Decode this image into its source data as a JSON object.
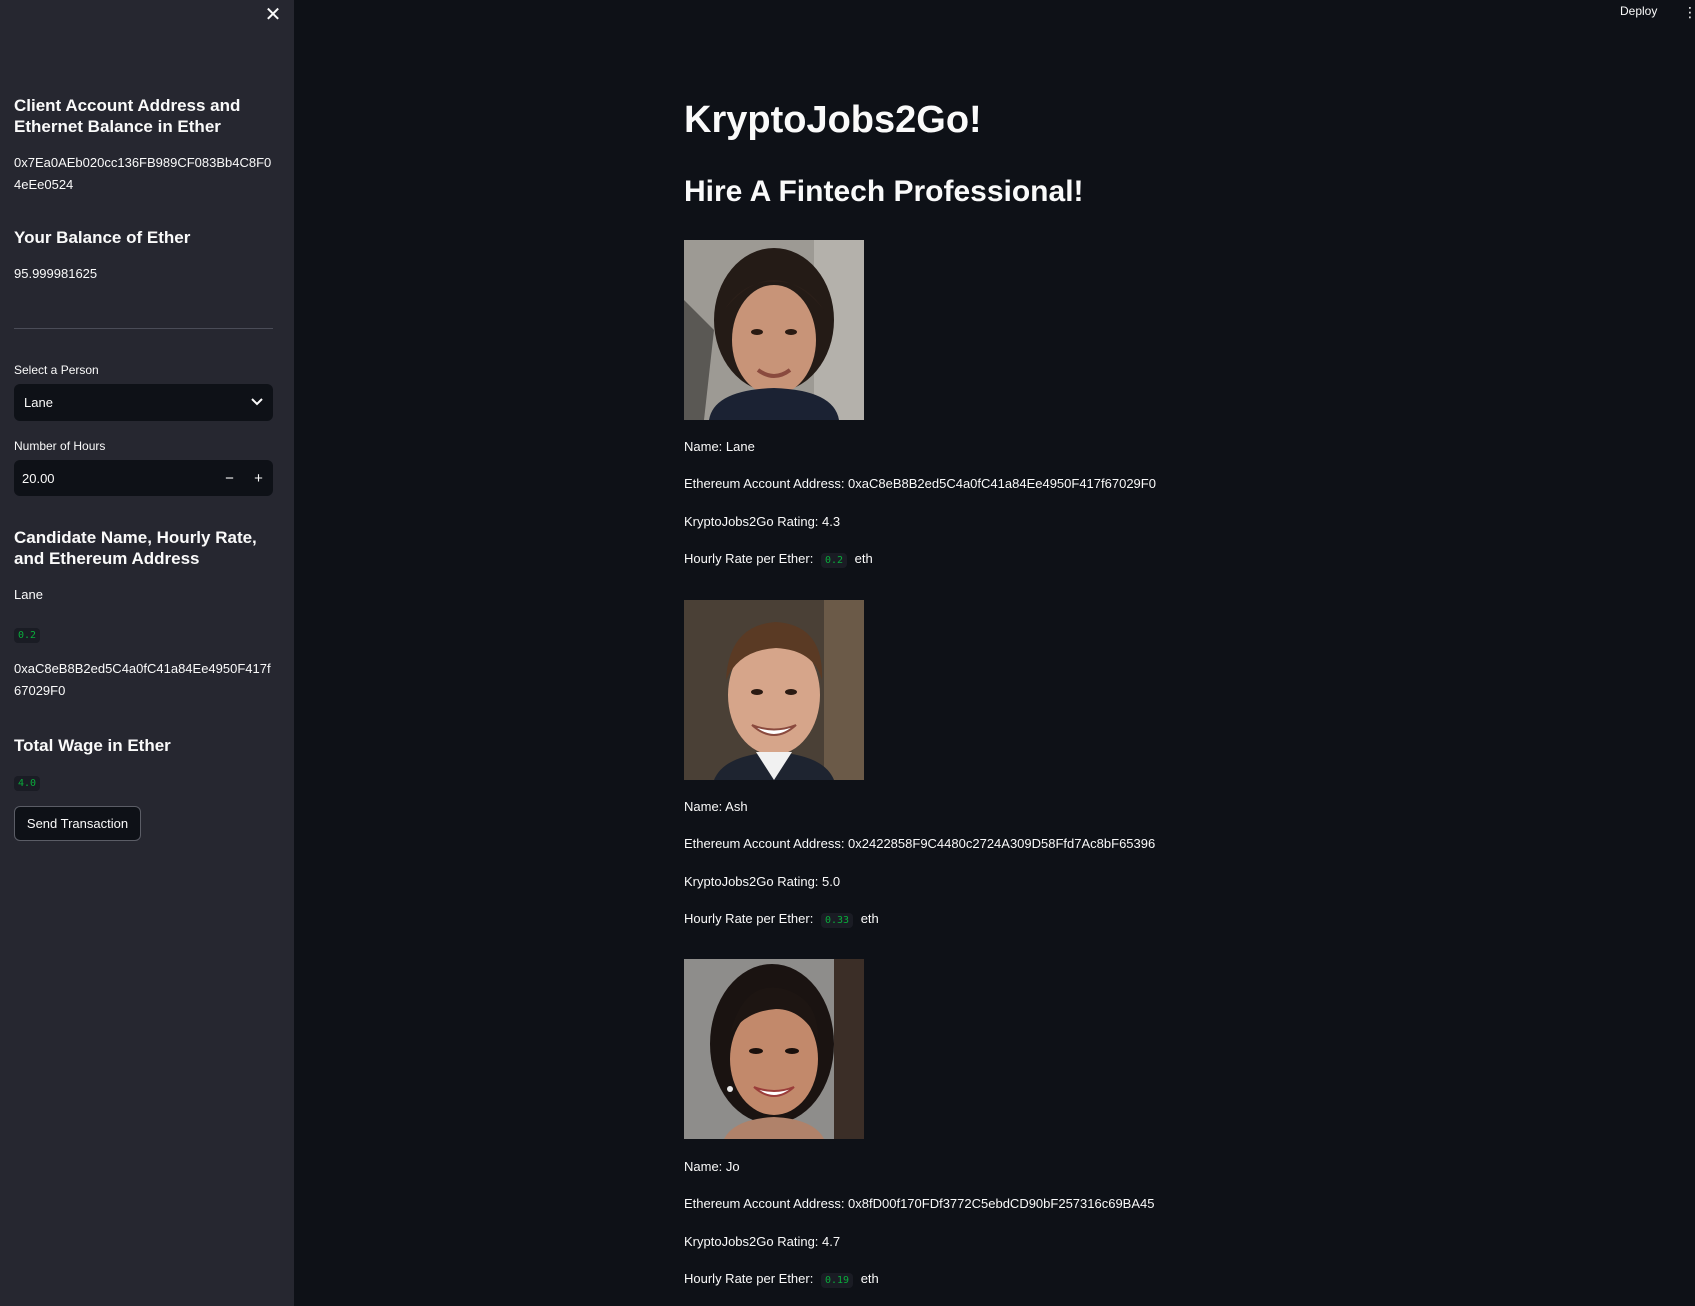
{
  "topbar": {
    "deploy_label": "Deploy",
    "menu_icon": "kebab-menu-icon"
  },
  "sidebar": {
    "close_icon": "close-icon",
    "account_heading": "Client Account Address and Ethernet Balance in Ether",
    "account_address": "0x7Ea0AEb020cc136FB989CF083Bb4C8F04eEe0524",
    "balance_heading": "Your Balance of Ether",
    "balance_value": "95.999981625",
    "select_label": "Select a Person",
    "select_value": "Lane",
    "hours_label": "Number of Hours",
    "hours_value": "20.00",
    "candidate_heading": "Candidate Name, Hourly Rate, and Ethereum Address",
    "candidate_name": "Lane",
    "candidate_rate": "0.2",
    "candidate_address": "0xaC8eB8B2ed5C4a0fC41a84Ee4950F417f67029F0",
    "wage_heading": "Total Wage in Ether",
    "wage_value": "4.0",
    "send_button": "Send Transaction"
  },
  "main": {
    "title": "KryptoJobs2Go!",
    "subtitle": "Hire A Fintech Professional!",
    "candidates": [
      {
        "name_line": "Name: Lane",
        "address_line": "Ethereum Account Address: 0xaC8eB8B2ed5C4a0fC41a84Ee4950F417f67029F0",
        "rating_line": "KryptoJobs2Go Rating: 4.3",
        "rate_prefix": "Hourly Rate per Ether:",
        "rate": "0.2",
        "rate_suffix": "eth"
      },
      {
        "name_line": "Name: Ash",
        "address_line": "Ethereum Account Address: 0x2422858F9C4480c2724A309D58Ffd7Ac8bF65396",
        "rating_line": "KryptoJobs2Go Rating: 5.0",
        "rate_prefix": "Hourly Rate per Ether:",
        "rate": "0.33",
        "rate_suffix": "eth"
      },
      {
        "name_line": "Name: Jo",
        "address_line": "Ethereum Account Address: 0x8fD00f170FDf3772C5ebdCD90bF257316c69BA45",
        "rating_line": "KryptoJobs2Go Rating: 4.7",
        "rate_prefix": "Hourly Rate per Ether:",
        "rate": "0.19",
        "rate_suffix": "eth"
      }
    ]
  }
}
